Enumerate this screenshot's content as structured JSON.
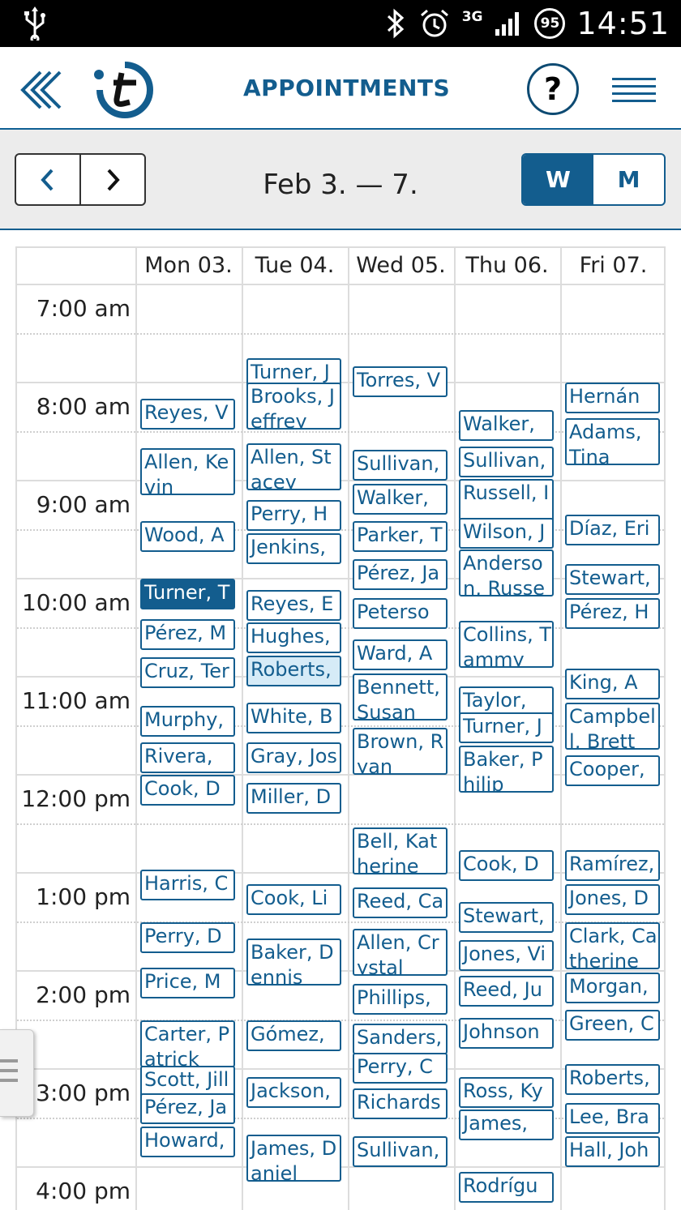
{
  "status_bar": {
    "time": "14:51",
    "network": "3G",
    "battery": "95"
  },
  "header": {
    "title": "APPOINTMENTS",
    "help_label": "?"
  },
  "nav": {
    "date_range": "Feb 3. — 7.",
    "view_week": "W",
    "view_month": "M",
    "active_view": "W"
  },
  "colors": {
    "brand": "#135d8e",
    "selected_bg": "#135d8e",
    "highlight_bg": "#d6ebf7",
    "status_bar_bg": "#000000",
    "nav_bg": "#ececec"
  },
  "days": [
    "Mon 03.",
    "Tue 04.",
    "Wed 05.",
    "Thu 06.",
    "Fri 07."
  ],
  "hours": [
    "7:00 am",
    "8:00 am",
    "9:00 am",
    "10:00 am",
    "11:00 am",
    "12:00 pm",
    "1:00 pm",
    "2:00 pm",
    "3:00 pm",
    "4:00 pm"
  ],
  "appointments": [
    {
      "day": 0,
      "start": "8:10",
      "label": "Reyes, V"
    },
    {
      "day": 0,
      "start": "8:40",
      "label": "Allen, Kevin"
    },
    {
      "day": 0,
      "start": "9:25",
      "label": "Wood, A"
    },
    {
      "day": 0,
      "start": "10:00",
      "label": "Turner, T",
      "state": "selected"
    },
    {
      "day": 0,
      "start": "10:25",
      "label": "Pérez, M"
    },
    {
      "day": 0,
      "start": "10:48",
      "label": "Cruz, Ter"
    },
    {
      "day": 0,
      "start": "11:18",
      "label": "Murphy,"
    },
    {
      "day": 0,
      "start": "11:40",
      "label": "Rivera, N"
    },
    {
      "day": 0,
      "start": "12:00",
      "label": "Cook, D"
    },
    {
      "day": 0,
      "start": "12:58",
      "label": "Harris, C"
    },
    {
      "day": 0,
      "start": "13:30",
      "label": "Perry, D"
    },
    {
      "day": 0,
      "start": "13:58",
      "label": "Price, M"
    },
    {
      "day": 0,
      "start": "14:30",
      "label": "Carter, Patrick"
    },
    {
      "day": 0,
      "start": "14:58",
      "label": "Scott, Jill"
    },
    {
      "day": 0,
      "start": "15:15",
      "label": "Pérez, Ja"
    },
    {
      "day": 0,
      "start": "15:35",
      "label": "Howard,"
    },
    {
      "day": 1,
      "start": "7:45",
      "label": "Turner, J"
    },
    {
      "day": 1,
      "start": "8:00",
      "label": "Brooks, Jeffrey"
    },
    {
      "day": 1,
      "start": "8:37",
      "label": "Allen, Stacey"
    },
    {
      "day": 1,
      "start": "9:12",
      "label": "Perry, H"
    },
    {
      "day": 1,
      "start": "9:32",
      "label": "Jenkins,"
    },
    {
      "day": 1,
      "start": "10:07",
      "label": "Reyes, E"
    },
    {
      "day": 1,
      "start": "10:27",
      "label": "Hughes,"
    },
    {
      "day": 1,
      "start": "10:47",
      "label": "Roberts,",
      "state": "highlight"
    },
    {
      "day": 1,
      "start": "11:16",
      "label": "White, B"
    },
    {
      "day": 1,
      "start": "11:40",
      "label": "Gray, Jos"
    },
    {
      "day": 1,
      "start": "12:05",
      "label": "Miller, D"
    },
    {
      "day": 1,
      "start": "13:07",
      "label": "Cook, Li"
    },
    {
      "day": 1,
      "start": "13:40",
      "label": "Baker, Dennis"
    },
    {
      "day": 1,
      "start": "14:30",
      "label": "Gómez,"
    },
    {
      "day": 1,
      "start": "15:05",
      "label": "Jackson,"
    },
    {
      "day": 1,
      "start": "15:40",
      "label": "James, Daniel"
    },
    {
      "day": 2,
      "start": "7:50",
      "label": "Torres, V"
    },
    {
      "day": 2,
      "start": "8:41",
      "label": "Sullivan,"
    },
    {
      "day": 2,
      "start": "9:02",
      "label": "Walker,"
    },
    {
      "day": 2,
      "start": "9:25",
      "label": "Parker, T"
    },
    {
      "day": 2,
      "start": "9:48",
      "label": "Pérez, Ja"
    },
    {
      "day": 2,
      "start": "10:12",
      "label": "Peterso"
    },
    {
      "day": 2,
      "start": "10:37",
      "label": "Ward, A"
    },
    {
      "day": 2,
      "start": "10:58",
      "label": "Bennett, Susan"
    },
    {
      "day": 2,
      "start": "11:31",
      "label": "Brown, Ryan"
    },
    {
      "day": 2,
      "start": "12:32",
      "label": "Bell, Katherine"
    },
    {
      "day": 2,
      "start": "13:09",
      "label": "Reed, Ca"
    },
    {
      "day": 2,
      "start": "13:34",
      "label": "Allen, Crystal"
    },
    {
      "day": 2,
      "start": "14:08",
      "label": "Phillips,"
    },
    {
      "day": 2,
      "start": "14:32",
      "label": "Sanders,"
    },
    {
      "day": 2,
      "start": "14:50",
      "label": "Perry, C"
    },
    {
      "day": 2,
      "start": "15:12",
      "label": "Richards"
    },
    {
      "day": 2,
      "start": "15:41",
      "label": "Sullivan,"
    },
    {
      "day": 3,
      "start": "8:17",
      "label": "Walker,"
    },
    {
      "day": 3,
      "start": "8:39",
      "label": "Sullivan,"
    },
    {
      "day": 3,
      "start": "8:59",
      "label": "Russell, I"
    },
    {
      "day": 3,
      "start": "9:23",
      "label": "Wilson, J"
    },
    {
      "day": 3,
      "start": "9:42",
      "label": "Anderson, Russe"
    },
    {
      "day": 3,
      "start": "10:26",
      "label": "Collins, Tammy"
    },
    {
      "day": 3,
      "start": "11:06",
      "label": "Taylor,"
    },
    {
      "day": 3,
      "start": "11:22",
      "label": "Turner, J"
    },
    {
      "day": 3,
      "start": "11:42",
      "label": "Baker, Philip"
    },
    {
      "day": 3,
      "start": "12:46",
      "label": "Cook, D"
    },
    {
      "day": 3,
      "start": "13:18",
      "label": "Stewart,"
    },
    {
      "day": 3,
      "start": "13:41",
      "label": "Jones, Vi"
    },
    {
      "day": 3,
      "start": "14:03",
      "label": "Reed, Ju"
    },
    {
      "day": 3,
      "start": "14:29",
      "label": "Johnson"
    },
    {
      "day": 3,
      "start": "15:05",
      "label": "Ross, Ky"
    },
    {
      "day": 3,
      "start": "15:25",
      "label": "James,"
    },
    {
      "day": 3,
      "start": "16:03",
      "label": "Rodrígu"
    },
    {
      "day": 4,
      "start": "8:00",
      "label": "Hernán"
    },
    {
      "day": 4,
      "start": "8:22",
      "label": "Adams, Tina"
    },
    {
      "day": 4,
      "start": "9:21",
      "label": "Díaz, Eri"
    },
    {
      "day": 4,
      "start": "9:51",
      "label": "Stewart,"
    },
    {
      "day": 4,
      "start": "10:12",
      "label": "Pérez, H"
    },
    {
      "day": 4,
      "start": "10:55",
      "label": "King, A"
    },
    {
      "day": 4,
      "start": "11:16",
      "label": "Campbell, Brett"
    },
    {
      "day": 4,
      "start": "11:48",
      "label": "Cooper,"
    },
    {
      "day": 4,
      "start": "12:46",
      "label": "Ramírez,"
    },
    {
      "day": 4,
      "start": "13:07",
      "label": "Jones, D"
    },
    {
      "day": 4,
      "start": "13:30",
      "label": "Clark, Catherine"
    },
    {
      "day": 4,
      "start": "14:01",
      "label": "Morgan,"
    },
    {
      "day": 4,
      "start": "14:24",
      "label": "Green, C"
    },
    {
      "day": 4,
      "start": "14:57",
      "label": "Roberts,"
    },
    {
      "day": 4,
      "start": "15:21",
      "label": "Lee, Bra"
    },
    {
      "day": 4,
      "start": "15:41",
      "label": "Hall, Joh"
    }
  ]
}
